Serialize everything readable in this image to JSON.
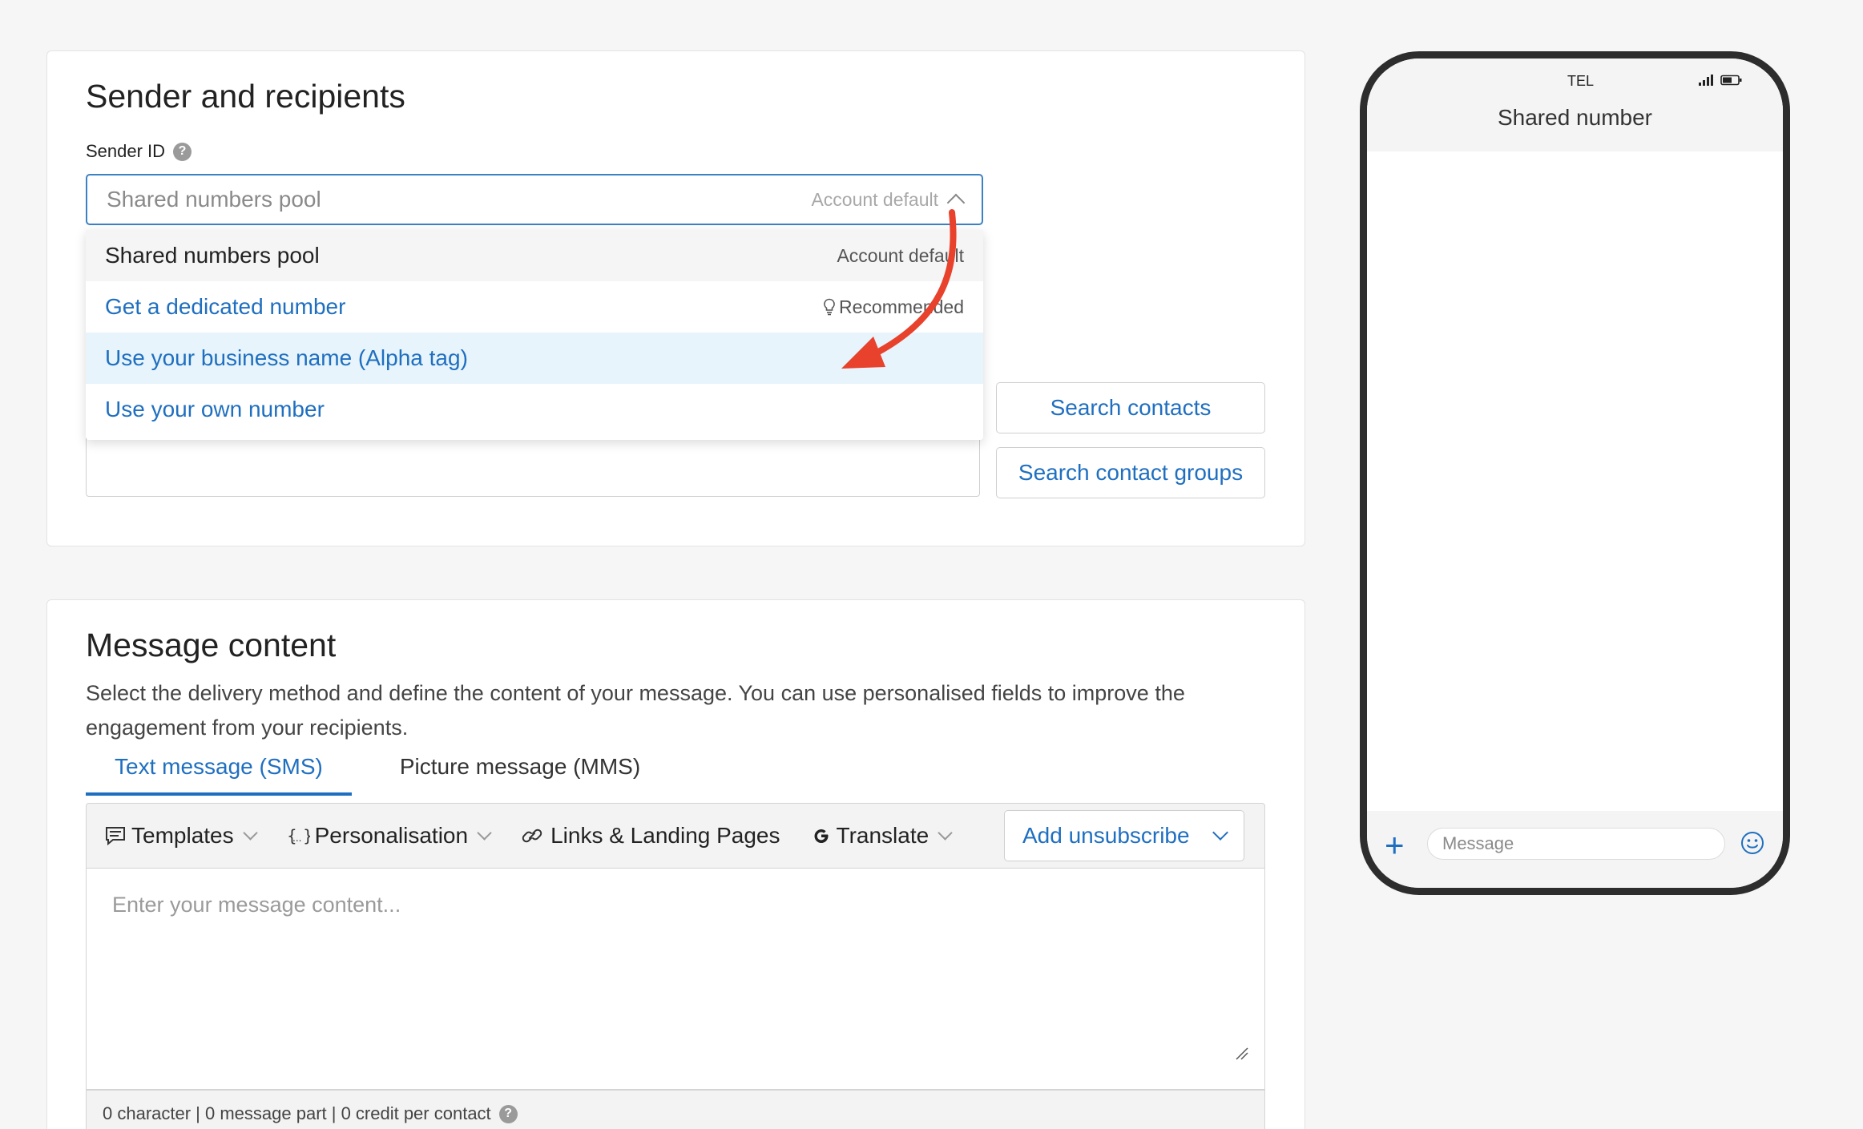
{
  "sender_card": {
    "title": "Sender and recipients",
    "sender_id_label": "Sender ID",
    "help_glyph": "?",
    "select": {
      "placeholder": "Shared numbers pool",
      "badge": "Account default"
    },
    "dropdown_items": [
      {
        "label": "Shared numbers pool",
        "meta": "Account default"
      },
      {
        "label": "Get a dedicated number",
        "meta": "Recommended",
        "meta_icon": "lightbulb-icon"
      },
      {
        "label": "Use your business name (Alpha tag)",
        "meta": ""
      },
      {
        "label": "Use your own number",
        "meta": ""
      }
    ],
    "search_contacts_label": "Search contacts",
    "search_groups_label": "Search contact groups"
  },
  "message_card": {
    "title": "Message content",
    "description": "Select the delivery method and define the content of your message. You can use personalised fields to improve the engagement from your recipients.",
    "tabs": [
      {
        "label": "Text message (SMS)",
        "active": true
      },
      {
        "label": "Picture message (MMS)",
        "active": false
      }
    ],
    "toolbar": {
      "templates": "Templates",
      "personalisation": "Personalisation",
      "links": "Links & Landing Pages",
      "translate": "Translate",
      "add_unsubscribe": "Add unsubscribe"
    },
    "textarea_placeholder": "Enter your message content...",
    "counter": "0 character | 0 message part | 0 credit per contact",
    "counter_help": "?"
  },
  "phone_preview": {
    "carrier": "TEL",
    "contact_name": "Shared number",
    "message_placeholder": "Message",
    "plus_glyph": "+"
  },
  "colors": {
    "accent": "#1f6fc0",
    "annotation_arrow": "#e8412c",
    "highlight_row": "#e7f4fb"
  }
}
